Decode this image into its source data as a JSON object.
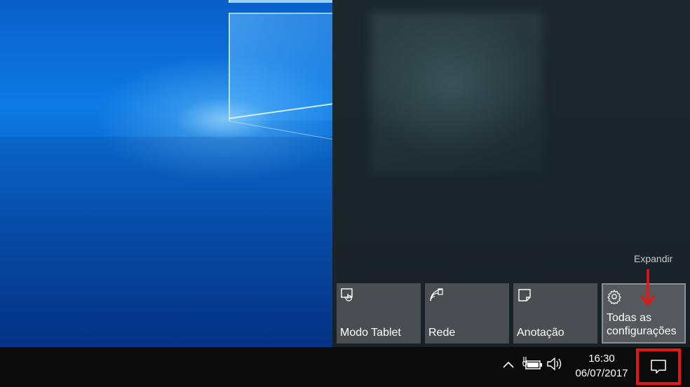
{
  "action_center": {
    "expand_label": "Expandir",
    "quick_actions": [
      {
        "label": "Modo Tablet",
        "icon": "tablet-mode-icon"
      },
      {
        "label": "Rede",
        "icon": "network-icon"
      },
      {
        "label": "Anotação",
        "icon": "note-icon"
      },
      {
        "label": "Todas as configurações",
        "icon": "gear-icon",
        "selected": true
      }
    ]
  },
  "taskbar": {
    "tray_icons": [
      "chevron-up-icon",
      "battery-power-icon",
      "volume-icon"
    ],
    "time": "16:30",
    "date": "06/07/2017",
    "action_center_icon": "notification-icon"
  },
  "colors": {
    "annotation": "#e81515",
    "tile": "#4a4d52",
    "taskbar": "#0b0b0b"
  }
}
